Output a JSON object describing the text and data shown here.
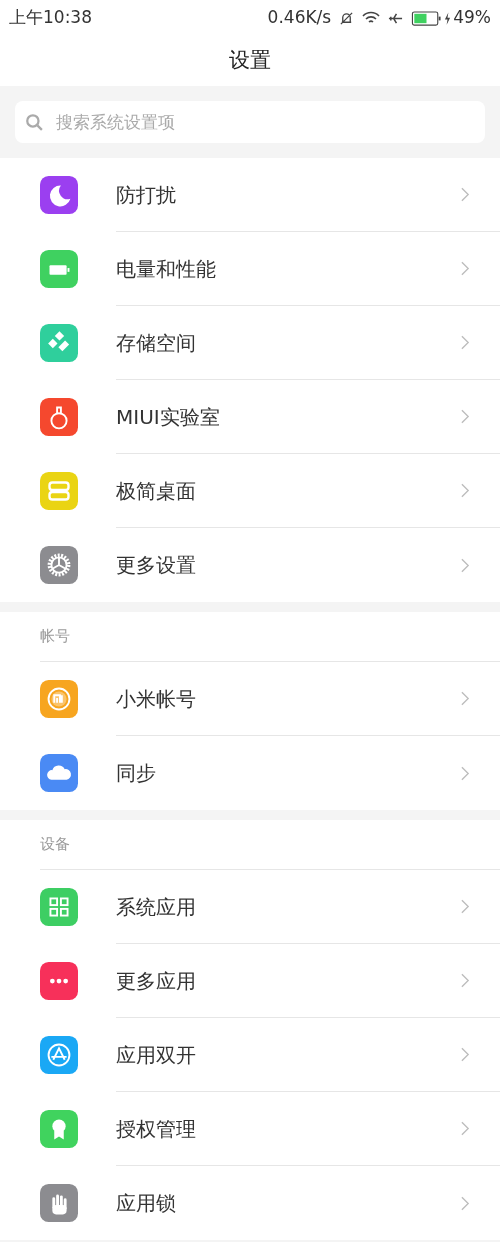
{
  "status_bar": {
    "time": "上午10:38",
    "speed": "0.46K/s",
    "battery": "49%"
  },
  "title": "设置",
  "search": {
    "placeholder": "搜索系统设置项"
  },
  "sections": [
    {
      "items": [
        {
          "label": "防打扰",
          "kind": "moon",
          "color": "#9b3ff0"
        },
        {
          "label": "电量和性能",
          "kind": "battery",
          "color": "#3fd160"
        },
        {
          "label": "存储空间",
          "kind": "storage",
          "color": "#2fcf9c"
        },
        {
          "label": "MIUI实验室",
          "kind": "flask",
          "color": "#f5482e"
        },
        {
          "label": "极简桌面",
          "kind": "desktop",
          "color": "#ead413"
        },
        {
          "label": "更多设置",
          "kind": "gear",
          "color": "#8c8c90"
        }
      ]
    },
    {
      "header": "帐号",
      "items": [
        {
          "label": "小米帐号",
          "kind": "mi",
          "color": "#f7a51f"
        },
        {
          "label": "同步",
          "kind": "cloud",
          "color": "#4a8af4"
        }
      ]
    },
    {
      "header": "设备",
      "items": [
        {
          "label": "系统应用",
          "kind": "grid",
          "color": "#3dce63"
        },
        {
          "label": "更多应用",
          "kind": "dots",
          "color": "#f7305a"
        },
        {
          "label": "应用双开",
          "kind": "appstore",
          "color": "#1aa8f5"
        },
        {
          "label": "授权管理",
          "kind": "badge",
          "color": "#40d35e"
        },
        {
          "label": "应用锁",
          "kind": "hand",
          "color": "#8c8c90"
        }
      ]
    }
  ]
}
